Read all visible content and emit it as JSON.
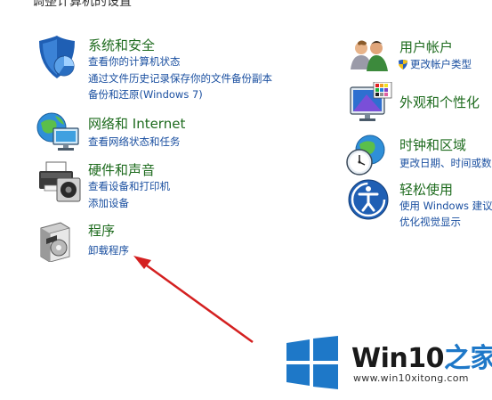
{
  "page": {
    "section_title": "调整计算机的设置"
  },
  "categories": {
    "security": {
      "title": "系统和安全",
      "links": [
        "查看你的计算机状态",
        "通过文件历史记录保存你的文件备份副本",
        "备份和还原(Windows 7)"
      ]
    },
    "network": {
      "title": "网络和 Internet",
      "links": [
        "查看网络状态和任务"
      ]
    },
    "hardware": {
      "title": "硬件和声音",
      "links": [
        "查看设备和打印机",
        "添加设备"
      ]
    },
    "programs": {
      "title": "程序",
      "links": [
        "卸载程序"
      ]
    },
    "accounts": {
      "title": "用户帐户",
      "links": [
        "更改帐户类型"
      ]
    },
    "appearance": {
      "title": "外观和个性化",
      "links": []
    },
    "clock": {
      "title": "时钟和区域",
      "links": [
        "更改日期、时间或数"
      ]
    },
    "ease": {
      "title": "轻松使用",
      "links": [
        "使用 Windows 建议",
        "优化视觉显示"
      ]
    }
  },
  "watermark": {
    "brand_main": "Win10",
    "brand_suffix": "之家",
    "url": "www.win10xitong.com"
  },
  "colors": {
    "category_title": "#1e6b1e",
    "link": "#1a4fa0",
    "arrow": "#d42020",
    "windows_logo": "#1e78c8"
  }
}
